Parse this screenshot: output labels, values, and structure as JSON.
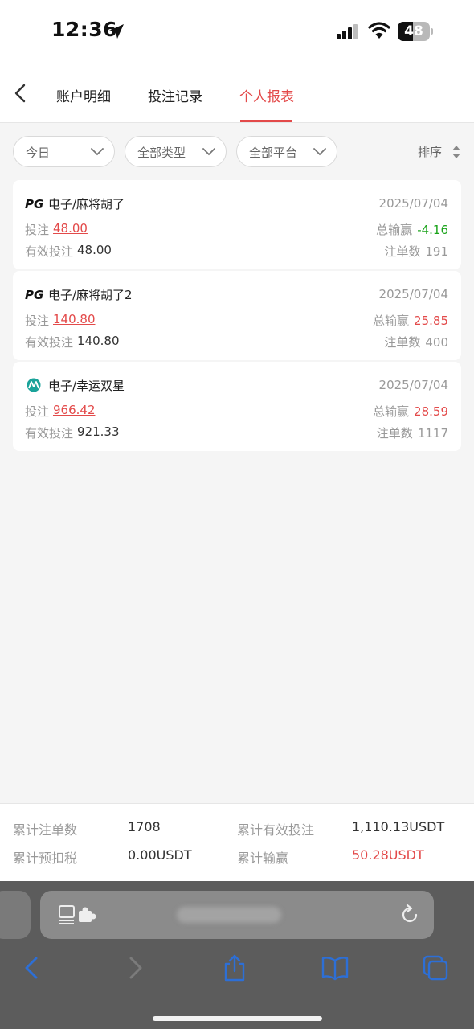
{
  "status_bar": {
    "time": "12:36",
    "battery": "48",
    "battery_level": 0.48,
    "icons": [
      "location-arrow-icon",
      "cellular-signal-icon",
      "wifi-icon",
      "battery-icon"
    ]
  },
  "header": {
    "tabs": [
      {
        "label": "账户明细",
        "active": false
      },
      {
        "label": "投注记录",
        "active": false
      },
      {
        "label": "个人报表",
        "active": true
      }
    ]
  },
  "filters": [
    {
      "label": "今日"
    },
    {
      "label": "全部类型"
    },
    {
      "label": "全部平台"
    }
  ],
  "sort": {
    "label": "排序"
  },
  "records": [
    {
      "logo": "PG",
      "name": "电子/麻将胡了",
      "date": "2025/07/04",
      "bet_label": "投注",
      "bet": "48.00",
      "winloss_label": "总输赢",
      "winloss": "-4.16",
      "winloss_color": "#1aa31a",
      "valid_label": "有效投注",
      "valid": "48.00",
      "count_label": "注单数",
      "count": "191"
    },
    {
      "logo": "PG",
      "name": "电子/麻将胡了2",
      "date": "2025/07/04",
      "bet_label": "投注",
      "bet": "140.80",
      "winloss_label": "总输赢",
      "winloss": "25.85",
      "winloss_color": "#e34a4a",
      "valid_label": "有效投注",
      "valid": "140.80",
      "count_label": "注单数",
      "count": "400"
    },
    {
      "logo": "microgaming-icon",
      "name": "电子/幸运双星",
      "date": "2025/07/04",
      "bet_label": "投注",
      "bet": "966.42",
      "winloss_label": "总输赢",
      "winloss": "28.59",
      "winloss_color": "#e34a4a",
      "valid_label": "有效投注",
      "valid": "921.33",
      "count_label": "注单数",
      "count": "1117"
    }
  ],
  "summary": {
    "total_count_label": "累计注单数",
    "total_count": "1708",
    "total_valid_label": "累计有效投注",
    "total_valid": "1,110.13USDT",
    "total_tax_label": "累计预扣税",
    "total_tax": "0.00USDT",
    "total_winloss_label": "累计输赢",
    "total_winloss": "50.28USDT"
  },
  "colors": {
    "accent": "#e34a4a",
    "loss_green": "#1aa31a",
    "browser_bar": "#5c5c5c",
    "browser_icon": "#2d6fd6"
  },
  "browser": {
    "icons": [
      "reader-icon",
      "extension-icon",
      "reload-icon",
      "back-icon",
      "forward-icon",
      "share-icon",
      "bookmarks-icon",
      "tabs-icon"
    ]
  }
}
